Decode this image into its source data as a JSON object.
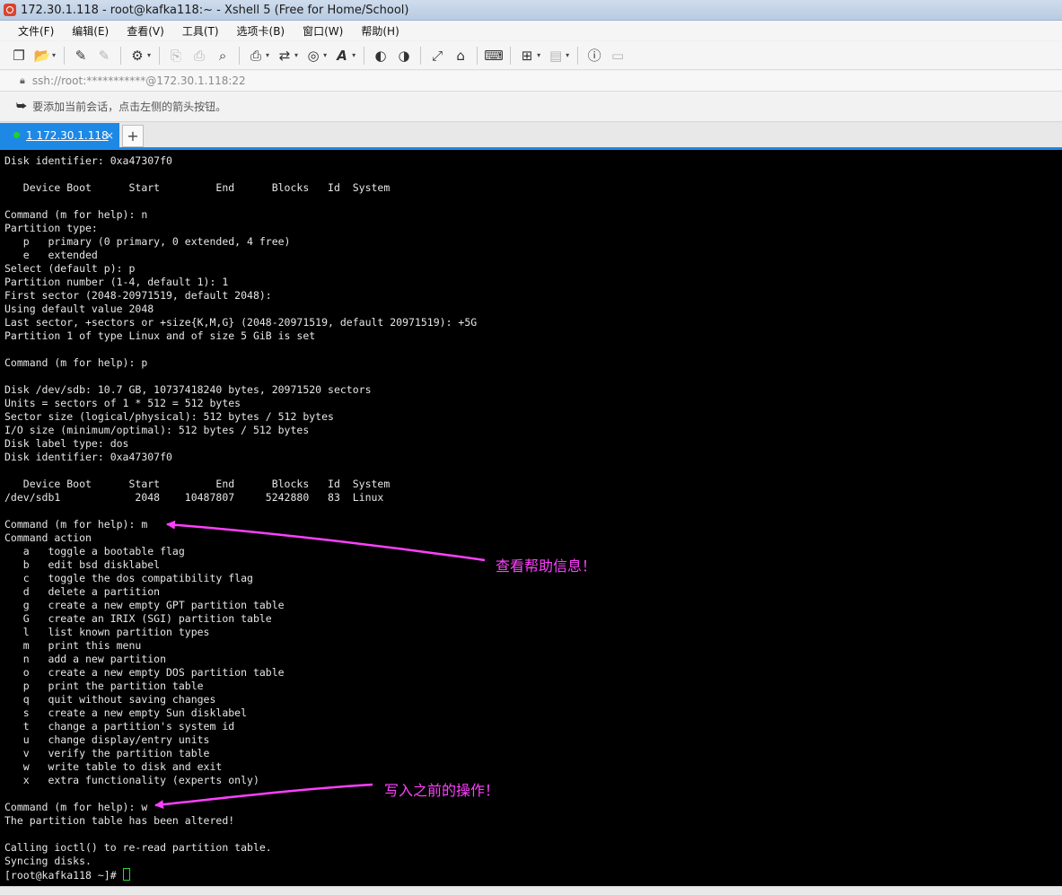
{
  "window": {
    "title": "172.30.1.118 - root@kafka118:~ - Xshell 5 (Free for Home/School)"
  },
  "menu": {
    "items": [
      "文件(F)",
      "编辑(E)",
      "查看(V)",
      "工具(T)",
      "选项卡(B)",
      "窗口(W)",
      "帮助(H)"
    ]
  },
  "toolbar": {
    "icons": [
      "new-session-icon",
      "open-folder-icon",
      "connect-icon",
      "disconnect-icon",
      "properties-icon",
      "copy-icon",
      "paste-icon",
      "find-icon",
      "print-icon",
      "transfer-icon",
      "globe-icon",
      "font-icon",
      "xftp-icon",
      "xshell-icon",
      "fullscreen-icon",
      "lock-icon",
      "keyboard-icon",
      "add-window-icon",
      "layout-icon",
      "help-icon",
      "chat-icon"
    ]
  },
  "address": {
    "text": "ssh://root:***********@172.30.1.118:22"
  },
  "hint": {
    "text": "要添加当前会话，点击左侧的箭头按钮。"
  },
  "tabs": [
    {
      "label": "1 172.30.1.118",
      "close": "×"
    }
  ],
  "add_tab": "+",
  "terminal": {
    "lines": [
      "Disk identifier: 0xa47307f0",
      "",
      "   Device Boot      Start         End      Blocks   Id  System",
      "",
      "Command (m for help): n",
      "Partition type:",
      "   p   primary (0 primary, 0 extended, 4 free)",
      "   e   extended",
      "Select (default p): p",
      "Partition number (1-4, default 1): 1",
      "First sector (2048-20971519, default 2048):",
      "Using default value 2048",
      "Last sector, +sectors or +size{K,M,G} (2048-20971519, default 20971519): +5G",
      "Partition 1 of type Linux and of size 5 GiB is set",
      "",
      "Command (m for help): p",
      "",
      "Disk /dev/sdb: 10.7 GB, 10737418240 bytes, 20971520 sectors",
      "Units = sectors of 1 * 512 = 512 bytes",
      "Sector size (logical/physical): 512 bytes / 512 bytes",
      "I/O size (minimum/optimal): 512 bytes / 512 bytes",
      "Disk label type: dos",
      "Disk identifier: 0xa47307f0",
      "",
      "   Device Boot      Start         End      Blocks   Id  System",
      "/dev/sdb1            2048    10487807     5242880   83  Linux",
      "",
      "Command (m for help): m",
      "Command action",
      "   a   toggle a bootable flag",
      "   b   edit bsd disklabel",
      "   c   toggle the dos compatibility flag",
      "   d   delete a partition",
      "   g   create a new empty GPT partition table",
      "   G   create an IRIX (SGI) partition table",
      "   l   list known partition types",
      "   m   print this menu",
      "   n   add a new partition",
      "   o   create a new empty DOS partition table",
      "   p   print the partition table",
      "   q   quit without saving changes",
      "   s   create a new empty Sun disklabel",
      "   t   change a partition's system id",
      "   u   change display/entry units",
      "   v   verify the partition table",
      "   w   write table to disk and exit",
      "   x   extra functionality (experts only)",
      "",
      "Command (m for help): w",
      "The partition table has been altered!",
      "",
      "Calling ioctl() to re-read partition table.",
      "Syncing disks.",
      "[root@kafka118 ~]# "
    ]
  },
  "annotations": {
    "help_note": "查看帮助信息！",
    "write_note": "写入之前的操作！",
    "color": "#ff40ff"
  }
}
